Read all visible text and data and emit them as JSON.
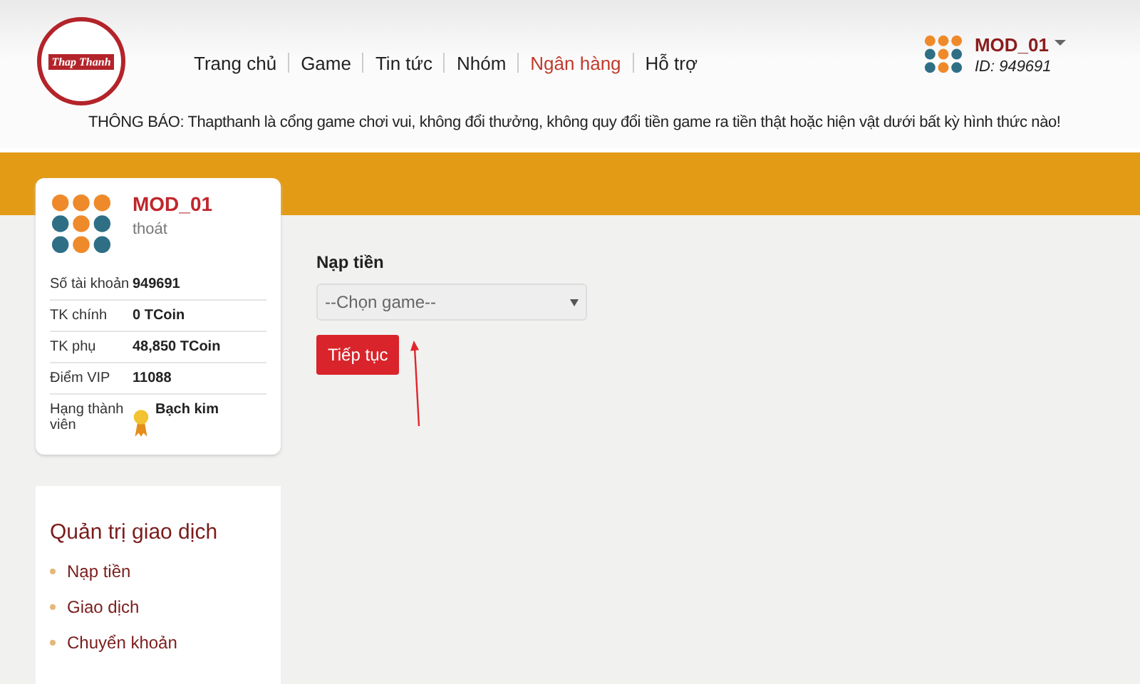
{
  "logo": {
    "text": "Thap Thanh"
  },
  "nav": [
    {
      "label": "Trang chủ",
      "selected": false
    },
    {
      "label": "Game",
      "selected": false
    },
    {
      "label": "Tin tức",
      "selected": false
    },
    {
      "label": "Nhóm",
      "selected": false
    },
    {
      "label": "Ngân hàng",
      "selected": true
    },
    {
      "label": "Hỗ trợ",
      "selected": false
    }
  ],
  "user_menu": {
    "name": "MOD_01",
    "id": "ID: 949691"
  },
  "notice": {
    "label": "THÔNG BÁO",
    "text": ": Thapthanh là cổng game chơi vui, không đổi thưởng, không quy đổi tiền game ra tiền thật hoặc hiện vật dưới bất kỳ hình thức nào!"
  },
  "profile": {
    "name": "MOD_01",
    "logout": "thoát",
    "rows": [
      {
        "label": "Số tài khoản",
        "value": "949691",
        "kind": "text"
      },
      {
        "label": "TK chính",
        "value": "0 TCoin",
        "kind": "text"
      },
      {
        "label": "TK phụ",
        "value": "48,850 TCoin",
        "kind": "text"
      },
      {
        "label": "Điểm VIP",
        "value": "11088",
        "kind": "text"
      },
      {
        "label": "Hạng thành viên",
        "value": "Bạch kim",
        "kind": "medal"
      }
    ]
  },
  "transactions": {
    "title": "Quản trị giao dịch",
    "items": [
      "Nạp tiền",
      "Giao dịch",
      "Chuyển khoản"
    ]
  },
  "form": {
    "title": "Nạp tiền",
    "select": "--Chọn game--",
    "button": "Tiếp tục"
  }
}
